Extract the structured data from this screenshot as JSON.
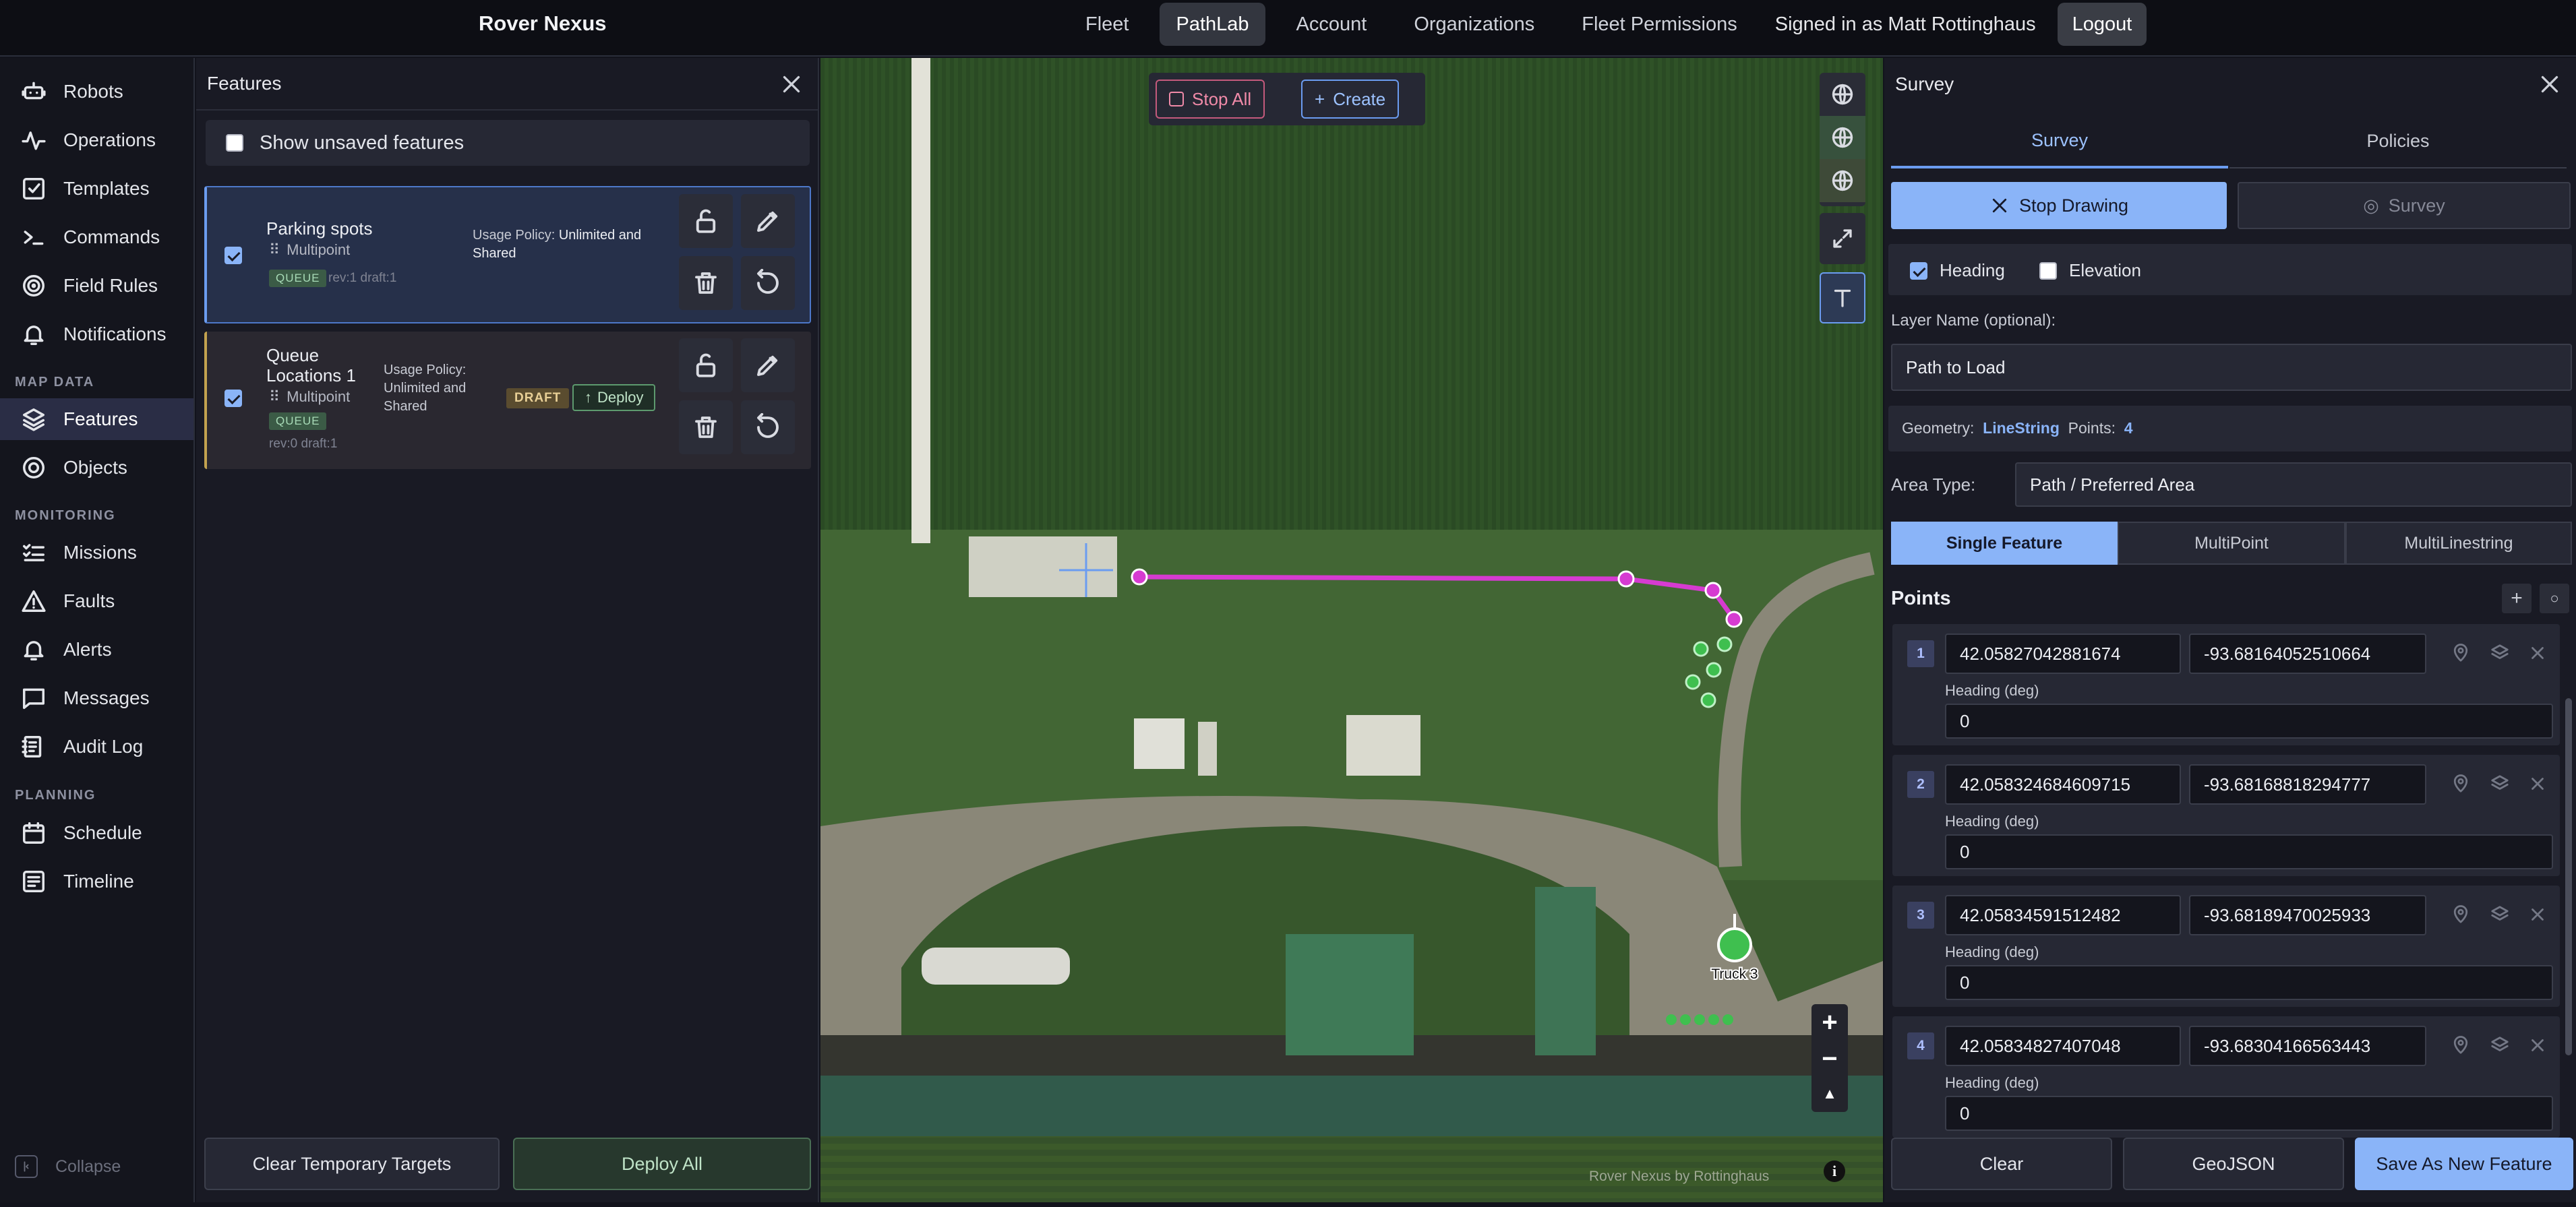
{
  "app": {
    "title": "Rover Nexus"
  },
  "topnav": {
    "items": [
      "Fleet",
      "PathLab",
      "Account",
      "Organizations",
      "Fleet Permissions"
    ],
    "signed_in": "Signed in as Matt Rottinghaus",
    "logout": "Logout"
  },
  "sidebar": {
    "items": [
      {
        "label": "Robots",
        "icon": "robot-icon"
      },
      {
        "label": "Operations",
        "icon": "activity-icon"
      },
      {
        "label": "Templates",
        "icon": "checkbox-icon"
      },
      {
        "label": "Commands",
        "icon": "terminal-icon"
      },
      {
        "label": "Field Rules",
        "icon": "target-icon"
      },
      {
        "label": "Notifications",
        "icon": "bell-icon"
      }
    ],
    "section_map": "MAP DATA",
    "map_items": [
      {
        "label": "Features",
        "icon": "layers-icon",
        "active": true
      },
      {
        "label": "Objects",
        "icon": "radar-icon"
      }
    ],
    "section_monitoring": "MONITORING",
    "monitoring_items": [
      {
        "label": "Missions",
        "icon": "list-check-icon"
      },
      {
        "label": "Faults",
        "icon": "warning-icon"
      },
      {
        "label": "Alerts",
        "icon": "bell-icon"
      },
      {
        "label": "Messages",
        "icon": "message-icon"
      },
      {
        "label": "Audit Log",
        "icon": "log-icon"
      }
    ],
    "section_planning": "PLANNING",
    "planning_items": [
      {
        "label": "Schedule",
        "icon": "calendar-icon"
      },
      {
        "label": "Timeline",
        "icon": "timeline-icon"
      }
    ],
    "collapse": "Collapse"
  },
  "features_panel": {
    "title": "Features",
    "show_unsaved": "Show unsaved features",
    "cards": [
      {
        "name": "Parking spots",
        "type": "Multipoint",
        "badge": "QUEUE",
        "rev": "rev:1 draft:1",
        "policy_label": "Usage Policy:",
        "policy_value": "Unlimited and Shared"
      },
      {
        "name_line1": "Queue",
        "name_line2": "Locations 1",
        "type": "Multipoint",
        "badge": "QUEUE",
        "rev": "rev:0 draft:1",
        "policy_label": "Usage Policy:",
        "policy_l1": "Unlimited and",
        "policy_l2": "Shared",
        "draft": "DRAFT",
        "deploy": "Deploy"
      }
    ],
    "clear_targets": "Clear Temporary Targets",
    "deploy_all": "Deploy All"
  },
  "map": {
    "stop_all": "Stop All",
    "create": "Create",
    "robot_label": "Truck 3",
    "attribution": "Rover Nexus by Rottinghaus",
    "colors": {
      "path": "#d63bd1",
      "queue": "#3fbf4f",
      "accent": "#8ab4f8"
    }
  },
  "survey": {
    "title": "Survey",
    "tabs": [
      "Survey",
      "Policies"
    ],
    "stop_drawing": "Stop Drawing",
    "survey_btn": "Survey",
    "heading": "Heading",
    "elevation": "Elevation",
    "layer_name_label": "Layer Name (optional):",
    "layer_name_value": "Path to Load",
    "geometry_label": "Geometry:",
    "geometry_value": "LineString",
    "points_label": "Points:",
    "points_value": "4",
    "area_type_label": "Area Type:",
    "area_type_value": "Path / Preferred Area",
    "segments": [
      "Single Feature",
      "MultiPoint",
      "MultiLinestring"
    ],
    "points_title": "Points",
    "points": [
      {
        "n": "1",
        "lat": "42.05827042881674",
        "lon": "-93.68164052510664",
        "heading_label": "Heading (deg)",
        "heading": "0"
      },
      {
        "n": "2",
        "lat": "42.058324684609715",
        "lon": "-93.68168818294777",
        "heading_label": "Heading (deg)",
        "heading": "0"
      },
      {
        "n": "3",
        "lat": "42.05834591512482",
        "lon": "-93.68189470025933",
        "heading_label": "Heading (deg)",
        "heading": "0"
      },
      {
        "n": "4",
        "lat": "42.05834827407048",
        "lon": "-93.68304166563443",
        "heading_label": "Heading (deg)",
        "heading": "0"
      }
    ],
    "clear": "Clear",
    "geojson": "GeoJSON",
    "save_new": "Save As New Feature"
  }
}
